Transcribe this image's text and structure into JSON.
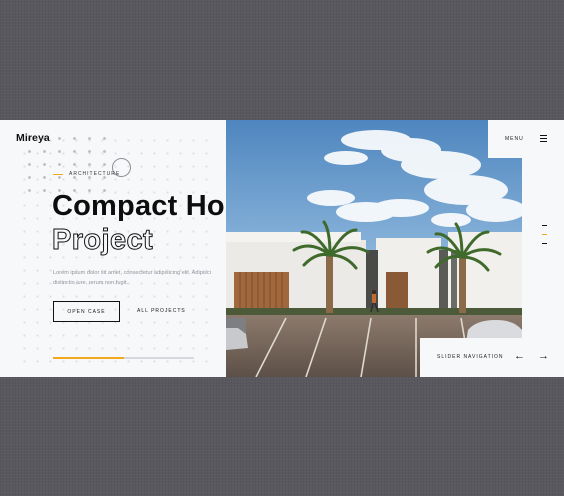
{
  "header": {
    "logo": "Mireya",
    "menu_label": "MENU"
  },
  "hero": {
    "category": "ARCHITECTURE",
    "title_line1": "Compact House",
    "title_line2": "Project",
    "description": "Lorem ipsum dolor sit amet, consectetur adipisicing elit. Adipisci distinctio iure, rerum non fugit.",
    "primary_button": "OPEN CASE",
    "secondary_link": "ALL PROJECTS",
    "progress": 0.5
  },
  "slider": {
    "navigation_label": "SLIDER NAVIGATION",
    "prev_arrow": "←",
    "next_arrow": "→",
    "active_index": 1
  },
  "colors": {
    "accent": "#f3a81d",
    "panel": "#f7f8fa",
    "backdrop": "#58585e",
    "text": "#111111"
  },
  "icons": [
    "hamburger-icon",
    "arrow-left-icon",
    "arrow-right-icon"
  ]
}
